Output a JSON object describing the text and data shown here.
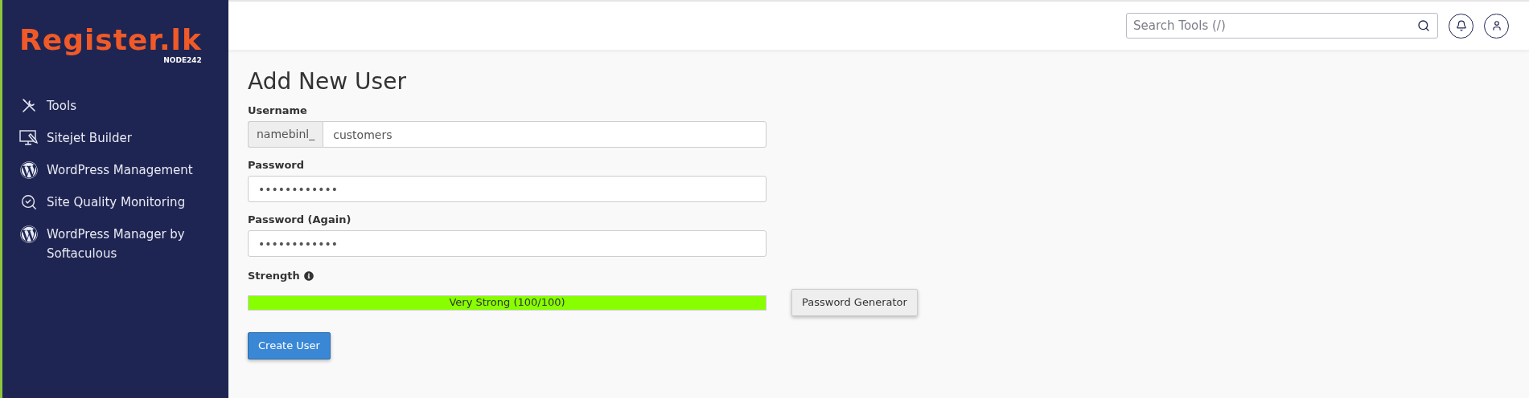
{
  "sidebar": {
    "logo": {
      "brand": "Register.lk",
      "node": "NODE242"
    },
    "items": [
      {
        "label": "Tools"
      },
      {
        "label": "Sitejet Builder"
      },
      {
        "label": "WordPress Management"
      },
      {
        "label": "Site Quality Monitoring"
      },
      {
        "label": "WordPress Manager by Softaculous"
      }
    ]
  },
  "header": {
    "search": {
      "placeholder": "Search Tools (/)"
    }
  },
  "form": {
    "title": "Add New User",
    "fields": [
      {
        "label": "Username",
        "prefix": "namebinl_",
        "value": "customers"
      },
      {
        "label": "Password",
        "value": "••••••••••••"
      },
      {
        "label": "Password (Again)",
        "value": "••••••••••••"
      }
    ],
    "strength": {
      "label": "Strength",
      "reading": "Very Strong (100/100)",
      "level": 1
    },
    "generator_button": "Password Generator",
    "submit_button": "Create User"
  }
}
